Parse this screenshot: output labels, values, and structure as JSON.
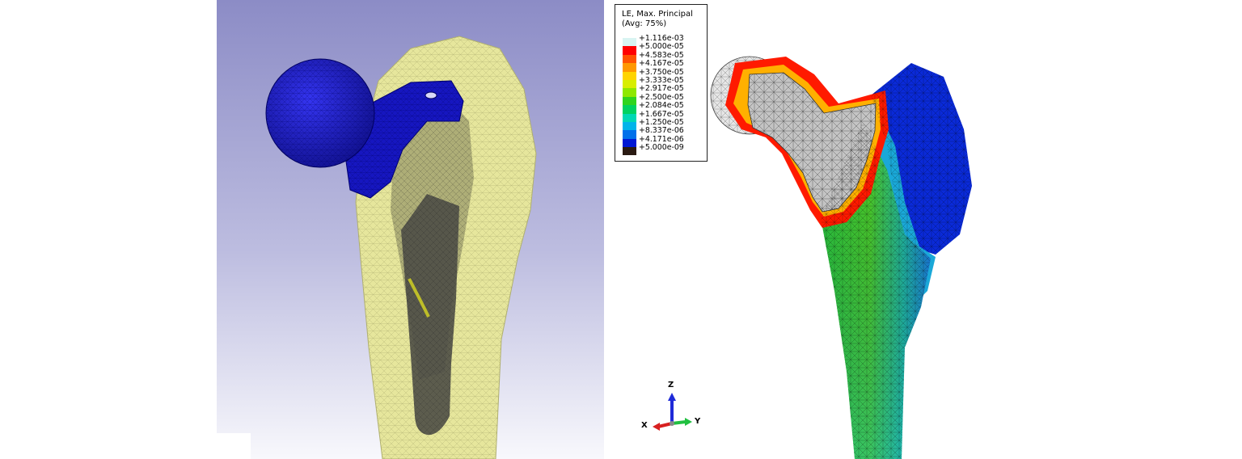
{
  "legend": {
    "title_line1": "LE, Max. Principal",
    "title_line2": "(Avg: 75%)",
    "labels": [
      "+1.116e-03",
      "+5.000e-05",
      "+4.583e-05",
      "+4.167e-05",
      "+3.750e-05",
      "+3.333e-05",
      "+2.917e-05",
      "+2.500e-05",
      "+2.084e-05",
      "+1.667e-05",
      "+1.250e-05",
      "+8.337e-06",
      "+4.171e-06",
      "+5.000e-09"
    ],
    "colors": [
      "#d8f4f2",
      "#ff0000",
      "#ff5200",
      "#ff9800",
      "#ffd400",
      "#d8ee00",
      "#8ee800",
      "#2fd41e",
      "#00d260",
      "#00d8b4",
      "#00b4ea",
      "#0070ea",
      "#0018d4",
      "#2a1a12"
    ]
  },
  "triad": {
    "z": "Z",
    "x": "X",
    "y": "Y"
  },
  "colors": {
    "bone": "#e8e8a0",
    "implant": "#1a1ad0",
    "background_top": "#8f8fc8",
    "background_bottom": "#ffffff",
    "cement": "#4a4a4a"
  }
}
